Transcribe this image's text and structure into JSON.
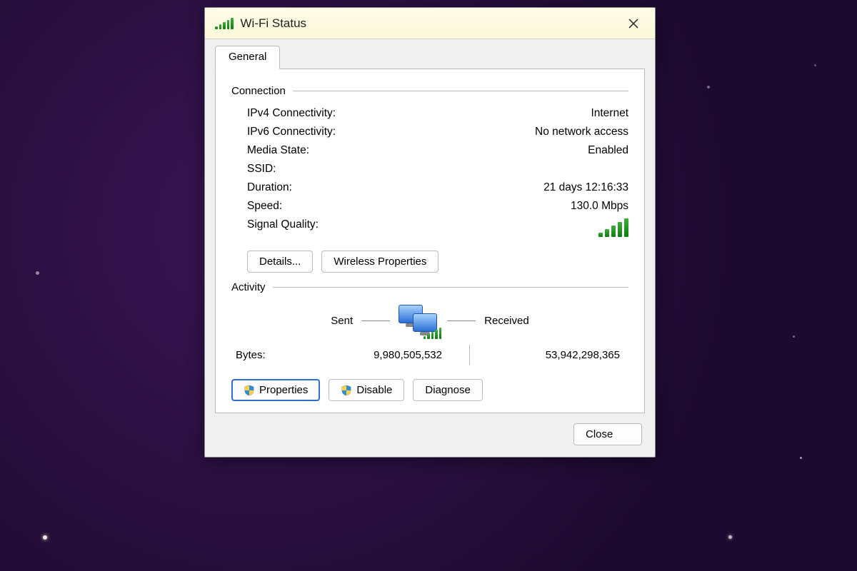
{
  "window": {
    "title": "Wi-Fi Status"
  },
  "tabs": {
    "general": "General"
  },
  "groups": {
    "connection": "Connection",
    "activity": "Activity"
  },
  "connection": {
    "ipv4_label": "IPv4 Connectivity:",
    "ipv4_value": "Internet",
    "ipv6_label": "IPv6 Connectivity:",
    "ipv6_value": "No network access",
    "media_label": "Media State:",
    "media_value": "Enabled",
    "ssid_label": "SSID:",
    "ssid_value": "",
    "duration_label": "Duration:",
    "duration_value": "21 days 12:16:33",
    "speed_label": "Speed:",
    "speed_value": "130.0 Mbps",
    "signal_label": "Signal Quality:"
  },
  "buttons": {
    "details": "Details...",
    "wireless_properties": "Wireless Properties",
    "properties": "Properties",
    "disable": "Disable",
    "diagnose": "Diagnose",
    "close": "Close"
  },
  "activity": {
    "sent_label": "Sent",
    "received_label": "Received",
    "bytes_label": "Bytes:",
    "bytes_sent": "9,980,505,532",
    "bytes_received": "53,942,298,365"
  }
}
